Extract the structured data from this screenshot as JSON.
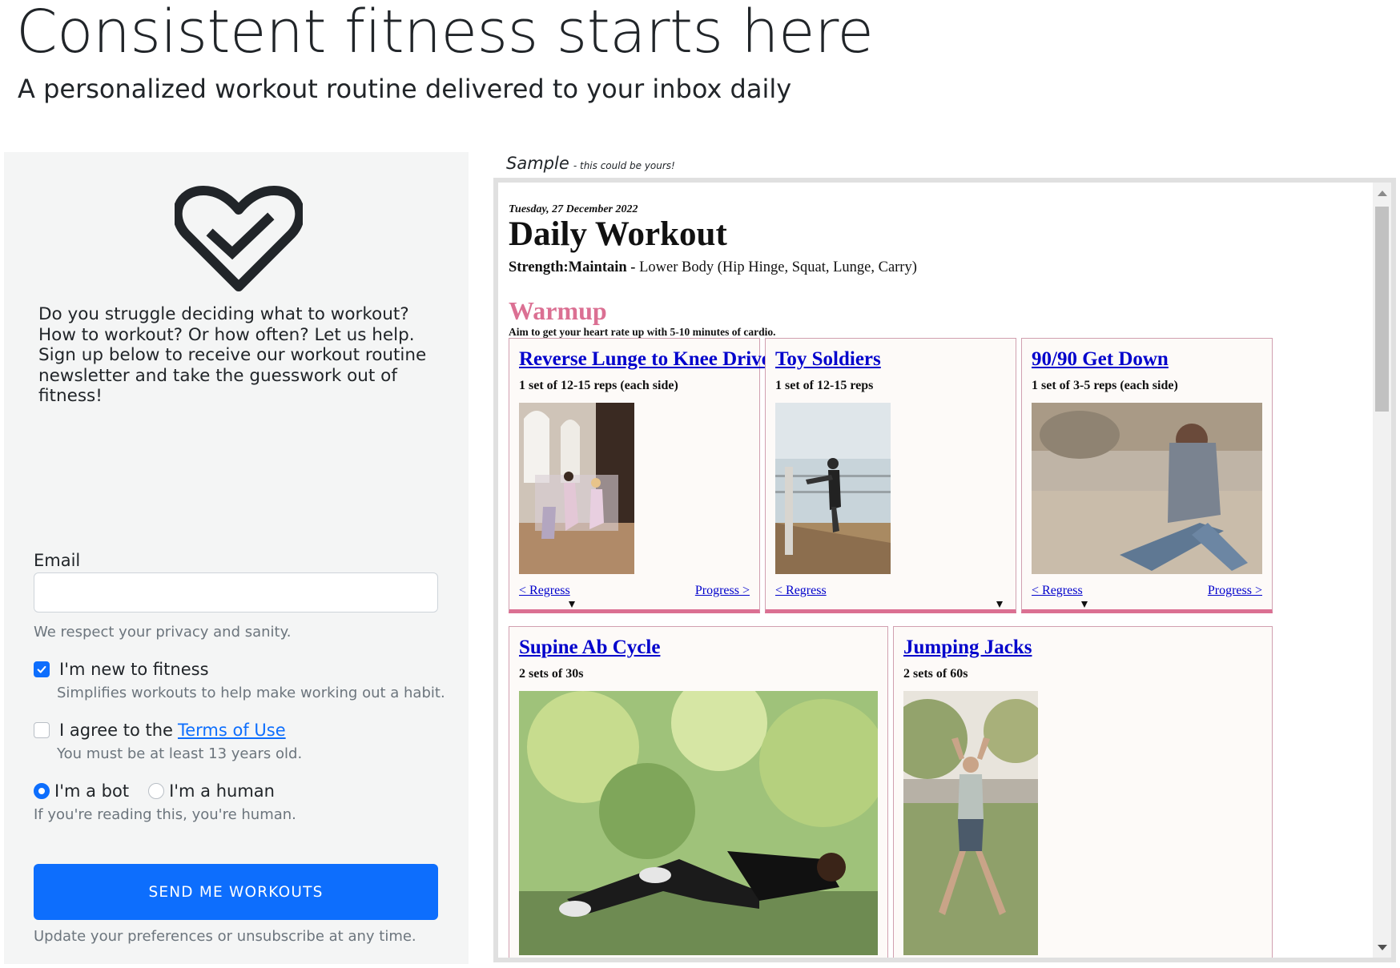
{
  "hero": {
    "title": "Consistent fitness starts here",
    "subtitle": "A personalized workout routine delivered to your inbox daily"
  },
  "signup": {
    "icon": "heart-check-icon",
    "intro": "Do you struggle deciding what to workout? How to workout? Or how often? Let us help. Sign up below to receive our workout routine newsletter and take the guesswork out of fitness!",
    "email_label": "Email",
    "email_value": "",
    "email_help": "We respect your privacy and sanity.",
    "new_to_fitness_label": "I'm new to fitness",
    "new_to_fitness_checked": true,
    "new_to_fitness_help": "Simplifies workouts to help make working out a habit.",
    "agree_label": "I agree to the",
    "terms_link": "Terms of Use",
    "agree_checked": false,
    "agree_help": "You must be at least 13 years old.",
    "radio_bot": "I'm a bot",
    "radio_human": "I'm a human",
    "radio_selected": "bot",
    "radio_help": "If you're reading this, you're human.",
    "submit": "SEND ME WORKOUTS",
    "footer": "Update your preferences or unsubscribe at any time."
  },
  "sample": {
    "label": "Sample",
    "note": "- this could be yours!",
    "date": "Tuesday, 27 December 2022",
    "title": "Daily Workout",
    "focus_bold": "Strength:Maintain -",
    "focus_rest": "Lower Body (Hip Hinge, Squat, Lunge, Carry)",
    "section_title": "Warmup",
    "section_desc": "Aim to get your heart rate up with 5-10 minutes of cardio.",
    "regress": "< Regress",
    "progress": "Progress >",
    "cards": [
      {
        "title": "Reverse Lunge to Knee Drive",
        "sets": "1 set of 12-15 reps (each side)"
      },
      {
        "title": "Toy Soldiers",
        "sets": "1 set of 12-15 reps"
      },
      {
        "title": "90/90 Get Down",
        "sets": "1 set of 3-5 reps (each side)"
      },
      {
        "title": "Supine Ab Cycle",
        "sets": "2 sets of 30s"
      },
      {
        "title": "Jumping Jacks",
        "sets": "2 sets of 60s"
      }
    ]
  },
  "colors": {
    "primary": "#0d6efd",
    "warmup_accent": "#db7093",
    "link": "#0000cc",
    "panel_bg": "#f4f5f5",
    "card_bg": "#fdfaf8"
  }
}
